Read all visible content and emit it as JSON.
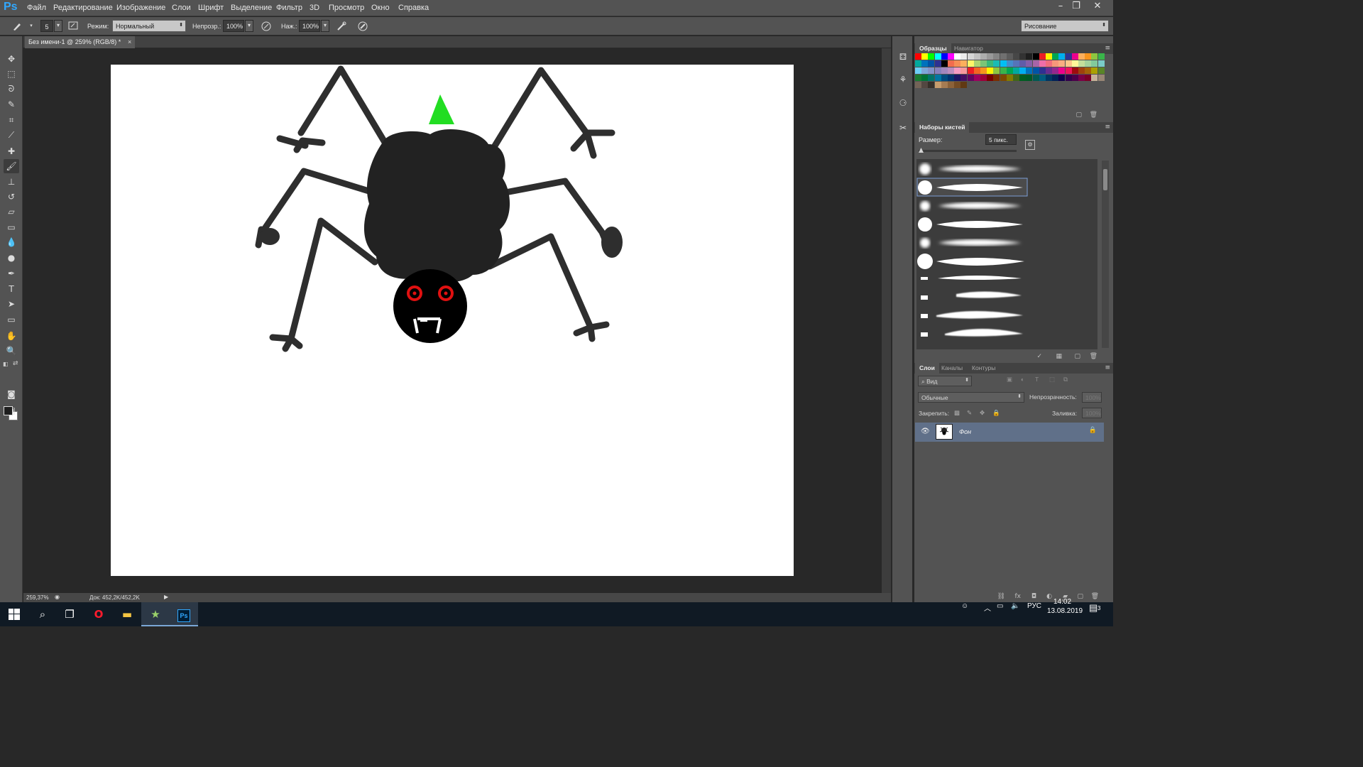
{
  "app": {
    "logo": "Ps",
    "window_controls": [
      "–",
      "❐",
      "✕"
    ]
  },
  "menu": [
    "Файл",
    "Редактирование",
    "Изображение",
    "Слои",
    "Шрифт",
    "Выделение",
    "Фильтр",
    "3D",
    "Просмотр",
    "Окно",
    "Справка"
  ],
  "options": {
    "brush_size": "5",
    "mode_label": "Режим:",
    "mode_value": "Нормальный",
    "opacity_label": "Непрозр.:",
    "opacity_value": "100%",
    "pressure_label": "Наж.:",
    "pressure_value": "100%",
    "workspace": "Рисование"
  },
  "document": {
    "tab_title": "Без имени-1 @ 259% (RGB/8) *",
    "zoom": "259,37%",
    "doc_info": "Док: 452,2K/452,2K",
    "art": {
      "body_color": "#222222",
      "head_color": "#000000",
      "hat_color": "#22dd22",
      "eye_color": "#e01010",
      "fang_color": "#ffffff",
      "leg_color": "#2e2e2e"
    }
  },
  "panels": {
    "swatches": {
      "tabs": [
        "Образцы",
        "Навигатор"
      ],
      "colors": [
        "#ff0000",
        "#ffff00",
        "#00ff00",
        "#00ffff",
        "#0000ff",
        "#ff00ff",
        "#ffffff",
        "#ebebeb",
        "#d6d6d6",
        "#c2c2c2",
        "#adadad",
        "#999999",
        "#858585",
        "#707070",
        "#5c5c5c",
        "#474747",
        "#333333",
        "#1f1f1f",
        "#000000",
        "#ed1c24",
        "#fff200",
        "#00a651",
        "#00aeef",
        "#2e3192",
        "#ec008c",
        "#fbaf5d",
        "#f7941d",
        "#8dc63f",
        "#39b54a",
        "#00a99d",
        "#0072bc",
        "#0054a6",
        "#2e3192",
        "#000000",
        "#f26c4f",
        "#f68e56",
        "#fbaf5d",
        "#fff568",
        "#acd372",
        "#7cc576",
        "#3bb878",
        "#1abbb4",
        "#00bff3",
        "#438ccb",
        "#5574b9",
        "#605ca8",
        "#855fa8",
        "#a864a8",
        "#f06ea9",
        "#f26d7d",
        "#f7977a",
        "#f9ad81",
        "#fdc68a",
        "#fff79a",
        "#c4df9b",
        "#a3d39c",
        "#82ca9c",
        "#7accc8",
        "#6dcff6",
        "#7da7d9",
        "#8393ca",
        "#8781bd",
        "#a187be",
        "#bc8dbf",
        "#f49ac2",
        "#f6989d",
        "#ed1c24",
        "#f26522",
        "#f7941d",
        "#fff200",
        "#8dc63f",
        "#39b54a",
        "#00a651",
        "#00a99d",
        "#00aeef",
        "#0072bc",
        "#0054a6",
        "#2e3192",
        "#662d91",
        "#92278f",
        "#ec008c",
        "#ed145b",
        "#9e0b0f",
        "#a0410d",
        "#a36209",
        "#aba000",
        "#598527",
        "#197b30",
        "#007236",
        "#00746b",
        "#0076a3",
        "#004b80",
        "#003471",
        "#1b1464",
        "#440e62",
        "#630460",
        "#9e005d",
        "#9e0039",
        "#790000",
        "#7b2e00",
        "#7d4900",
        "#827b00",
        "#406618",
        "#005e20",
        "#005826",
        "#005952",
        "#005b7f",
        "#003663",
        "#002157",
        "#0d004c",
        "#32004b",
        "#4b0049",
        "#7b0046",
        "#7a0026",
        "#c7b299",
        "#998675",
        "#736357",
        "#534741",
        "#37302a",
        "#c69c6d",
        "#a67c52",
        "#8c6239",
        "#754c24",
        "#603913"
      ]
    },
    "brush_presets": {
      "title": "Наборы кистей",
      "size_label": "Размер:",
      "size_value": "5 пикс."
    },
    "layers": {
      "tabs": [
        "Слои",
        "Каналы",
        "Контуры"
      ],
      "filter_kind": "Вид",
      "blend_mode": "Обычные",
      "opacity_label": "Непрозрачность:",
      "opacity_value": "100%",
      "lock_label": "Закрепить:",
      "fill_label": "Заливка:",
      "fill_value": "100%",
      "items": [
        {
          "name": "Фон",
          "visible": true,
          "locked": true
        }
      ]
    }
  },
  "taskbar": {
    "lang": "РУС",
    "time": "14:02",
    "date": "13.08.2019",
    "notifications": "3"
  }
}
